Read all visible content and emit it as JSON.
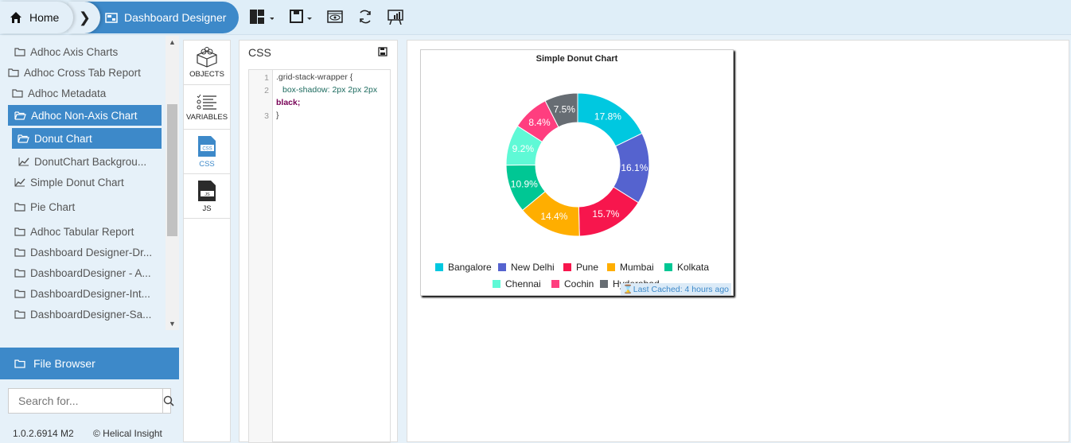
{
  "topbar": {
    "home": "Home",
    "current": "Dashboard Designer",
    "tools": [
      "layout-icon",
      "save-icon",
      "preview-icon",
      "refresh-icon",
      "presentation-icon"
    ]
  },
  "tree": [
    {
      "label": "Adhoc Axis Charts",
      "type": "folder"
    },
    {
      "label": "Adhoc Cross Tab Report",
      "type": "folder"
    },
    {
      "label": "Adhoc Metadata",
      "type": "folder"
    },
    {
      "label": "Adhoc Non-Axis Chart",
      "type": "folder-open",
      "selected": true
    },
    {
      "label": "Donut Chart",
      "type": "folder-open",
      "selected": true
    },
    {
      "label": "DonutChart Backgrou...",
      "type": "report"
    },
    {
      "label": "Simple Donut Chart",
      "type": "report"
    },
    {
      "label": "Pie Chart",
      "type": "folder"
    },
    {
      "label": "Adhoc Tabular Report",
      "type": "folder"
    },
    {
      "label": "Dashboard Designer-Dr...",
      "type": "folder"
    },
    {
      "label": "DashboardDesigner - A...",
      "type": "folder"
    },
    {
      "label": "DashboardDesigner-Int...",
      "type": "folder"
    },
    {
      "label": "DashboardDesigner-Sa...",
      "type": "folder"
    }
  ],
  "file_browser": "File Browser",
  "search": {
    "placeholder": "Search for..."
  },
  "footer": {
    "version": "1.0.2.6914 M2",
    "copyright": "© Helical Insight"
  },
  "side_icons": [
    {
      "label": "OBJECTS"
    },
    {
      "label": "VARIABLES"
    },
    {
      "label": "CSS",
      "active": true
    },
    {
      "label": "JS"
    }
  ],
  "css_panel": {
    "title": "CSS",
    "lines": [
      "1",
      "2",
      "3"
    ],
    "code": [
      ".grid-stack-wrapper {",
      "box-shadow: 2px 2px 2px",
      "black;",
      "}"
    ]
  },
  "chart_card": {
    "cached": "Last Cached: 4 hours ago"
  },
  "chart_data": {
    "type": "pie",
    "donut": true,
    "title": "Simple Donut Chart",
    "categories": [
      "Bangalore",
      "New Delhi",
      "Pune",
      "Mumbai",
      "Kolkata",
      "Chennai",
      "Cochin",
      "Hyderabad"
    ],
    "values": [
      17.8,
      16.1,
      15.7,
      14.4,
      10.9,
      9.2,
      8.4,
      7.5
    ],
    "labels": [
      "17.8%",
      "16.1%",
      "15.7%",
      "14.4%",
      "10.9%",
      "9.2%",
      "8.4%",
      "7.5%"
    ],
    "colors": [
      "#00c8e0",
      "#5563cf",
      "#f7164d",
      "#ffae00",
      "#00c794",
      "#5ff9d6",
      "#ff3e7f",
      "#676d73"
    ],
    "legend": "bottom"
  }
}
